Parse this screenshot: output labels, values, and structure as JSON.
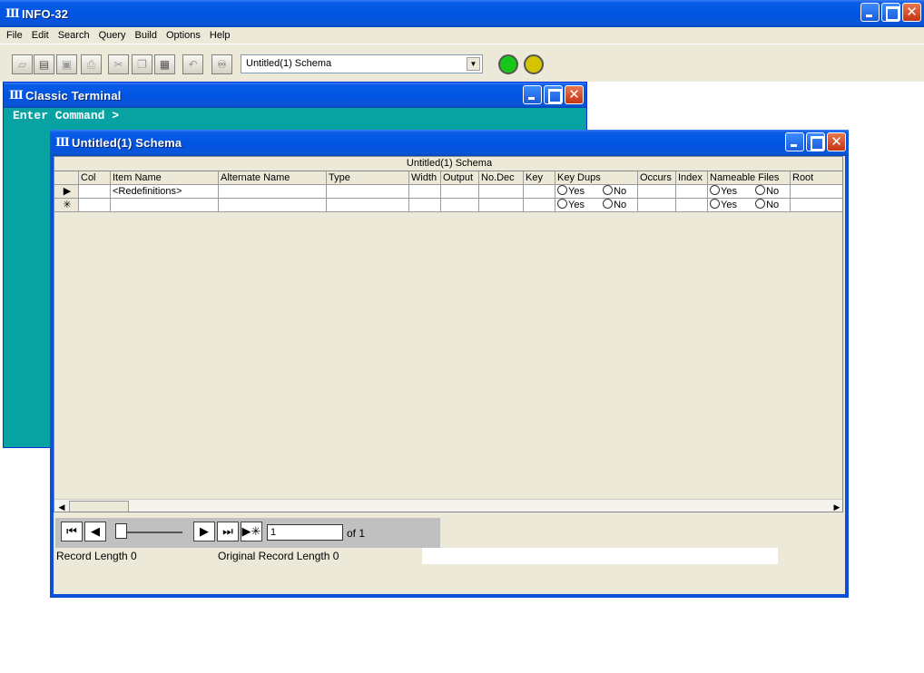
{
  "app": {
    "title": "INFO-32"
  },
  "menu": [
    "File",
    "Edit",
    "Search",
    "Query",
    "Build",
    "Options",
    "Help"
  ],
  "toolbar": {
    "schema_selected": "Untitled(1) Schema",
    "status_colors": {
      "green": "#18c818",
      "yellow": "#d4c400"
    }
  },
  "terminal": {
    "title": "Classic Terminal",
    "prompt": "Enter Command >"
  },
  "schema_window": {
    "title": "Untitled(1) Schema",
    "grid_caption": "Untitled(1) Schema",
    "columns": [
      "Col",
      "Item Name",
      "Alternate Name",
      "Type",
      "Width",
      "Output",
      "No.Dec",
      "Key",
      "Key Dups",
      "Occurs",
      "Index",
      "Nameable Files",
      "Root"
    ],
    "rows": [
      {
        "marker": "▶",
        "item_name": "<Redefinitions>",
        "key_dups_yes": "Yes",
        "key_dups_no": "No",
        "nameable_yes": "Yes",
        "nameable_no": "No"
      },
      {
        "marker": "✳",
        "item_name": "",
        "key_dups_yes": "Yes",
        "key_dups_no": "No",
        "nameable_yes": "Yes",
        "nameable_no": "No"
      }
    ],
    "navigator": {
      "record": "1",
      "of_label": "of 1"
    },
    "record_length": "Record Length 0",
    "original_record_length": "Original Record Length 0"
  }
}
